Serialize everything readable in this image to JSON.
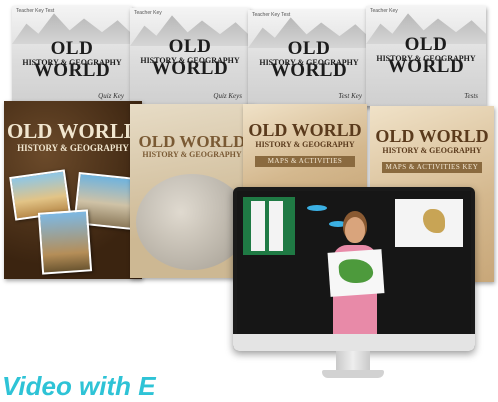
{
  "covers": {
    "c1": {
      "label_small": "Teacher Key Test",
      "title_a": "Old World",
      "title_b": "History & Geography",
      "footer": "Quiz Key"
    },
    "c2": {
      "label_small": "Teacher Key",
      "title_a": "Old World",
      "title_b": "History & Geography",
      "footer": "Quiz Keys"
    },
    "c3": {
      "label_small": "Teacher Key Test",
      "title_a": "Old World",
      "title_b": "History & Geography",
      "footer": "Test Key"
    },
    "c4": {
      "label_small": "Teacher Key",
      "title_a": "Old World",
      "title_b": "History & Geography",
      "footer": "Tests"
    },
    "c5": {
      "label_small": "",
      "title_a": "Old World",
      "title_b": "History & Geography"
    },
    "c6": {
      "label_small": "",
      "title_a": "Old World",
      "title_b": "History & Geography"
    },
    "c7": {
      "label_small": "",
      "title_a": "Old World",
      "title_b": "History & Geography",
      "ribbon": "Maps & Activities"
    },
    "c8": {
      "label_small": "",
      "title_a": "Old World",
      "title_b": "History & Geography",
      "ribbon": "Maps & Activities Key"
    }
  },
  "headline": "Video with E"
}
